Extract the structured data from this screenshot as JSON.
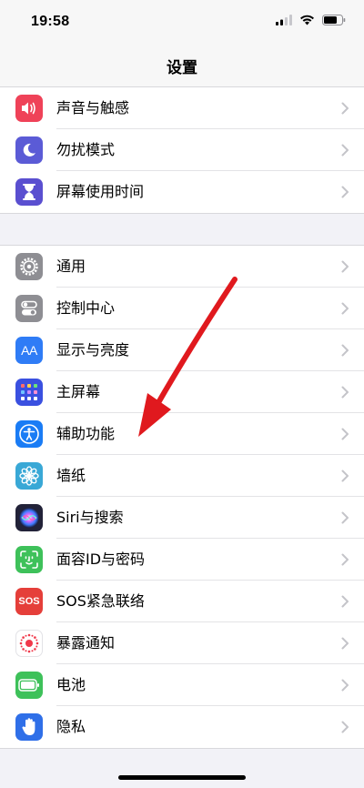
{
  "status_bar": {
    "time": "19:58"
  },
  "nav": {
    "title": "设置"
  },
  "colors": {
    "sounds": "#ef4258",
    "focus": "#5b5bd6",
    "screentime": "#5a4fd0",
    "general": "#8e8e93",
    "control": "#8e8e93",
    "display": "#2f7cf6",
    "home": "#3a50e0",
    "accessibility": "#1a7cf5",
    "wallpaper": "#39a8d6",
    "siri": "#222238",
    "faceid": "#3ec15a",
    "sos": "#e53f3a",
    "exposure": "#ffffff",
    "battery": "#3ec15a",
    "privacy": "#2f6fe8",
    "annotation_arrow": "#e0191e"
  },
  "group1": [
    {
      "label": "声音与触感",
      "icon": "speaker-icon"
    },
    {
      "label": "勿扰模式",
      "icon": "moon-icon"
    },
    {
      "label": "屏幕使用时间",
      "icon": "hourglass-icon"
    }
  ],
  "group2": [
    {
      "label": "通用",
      "icon": "gear-icon"
    },
    {
      "label": "控制中心",
      "icon": "toggles-icon"
    },
    {
      "label": "显示与亮度",
      "icon": "text-size-icon",
      "icon_text": "AA"
    },
    {
      "label": "主屏幕",
      "icon": "app-grid-icon"
    },
    {
      "label": "辅助功能",
      "icon": "accessibility-icon"
    },
    {
      "label": "墙纸",
      "icon": "flower-icon"
    },
    {
      "label": "Siri与搜索",
      "icon": "siri-icon"
    },
    {
      "label": "面容ID与密码",
      "icon": "face-id-icon"
    },
    {
      "label": "SOS紧急联络",
      "icon": "sos-icon",
      "icon_text": "SOS"
    },
    {
      "label": "暴露通知",
      "icon": "exposure-icon"
    },
    {
      "label": "电池",
      "icon": "battery-icon"
    },
    {
      "label": "隐私",
      "icon": "hand-icon"
    }
  ]
}
